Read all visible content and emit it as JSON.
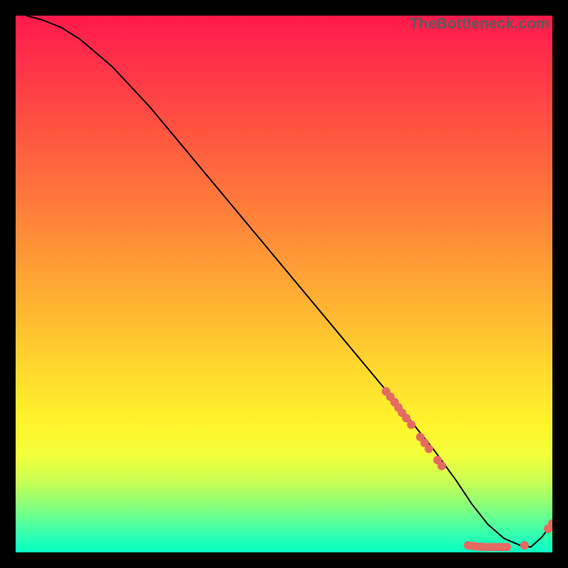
{
  "watermark": "TheBottleneck.com",
  "chart_data": {
    "type": "line",
    "title": "",
    "xlabel": "",
    "ylabel": "",
    "xlim": [
      0,
      100
    ],
    "ylim": [
      0,
      100
    ],
    "grid": false,
    "legend": false,
    "series": [
      {
        "name": "curve",
        "color": "#000000",
        "x": [
          2,
          5,
          8.5,
          12,
          18,
          25,
          35,
          45,
          55,
          65,
          70,
          74,
          78,
          82,
          85,
          88,
          91,
          94,
          96,
          98,
          100
        ],
        "y": [
          100,
          99.2,
          97.8,
          95.6,
          90.5,
          83,
          71,
          59,
          47,
          35,
          29,
          24,
          19,
          13.5,
          9,
          5.2,
          2.6,
          1.3,
          1.0,
          2.8,
          5.4
        ]
      }
    ],
    "point_clusters": [
      {
        "name": "upper-segment-dots",
        "color": "#e46a62",
        "radius_px": 6,
        "points": [
          {
            "x": 69.0,
            "y": 30.0
          },
          {
            "x": 69.8,
            "y": 29.0
          },
          {
            "x": 70.6,
            "y": 28.0
          },
          {
            "x": 71.3,
            "y": 27.0
          },
          {
            "x": 72.0,
            "y": 26.0
          },
          {
            "x": 72.8,
            "y": 25.0
          },
          {
            "x": 73.7,
            "y": 23.8
          },
          {
            "x": 75.4,
            "y": 21.5
          },
          {
            "x": 76.2,
            "y": 20.4
          },
          {
            "x": 77.0,
            "y": 19.3
          },
          {
            "x": 78.6,
            "y": 17.2
          },
          {
            "x": 79.4,
            "y": 16.1
          }
        ]
      },
      {
        "name": "bottom-flat-dots",
        "color": "#e46a62",
        "radius_px": 6,
        "points": [
          {
            "x": 84.3,
            "y": 1.3
          },
          {
            "x": 85.1,
            "y": 1.2
          },
          {
            "x": 85.9,
            "y": 1.1
          },
          {
            "x": 86.7,
            "y": 1.05
          },
          {
            "x": 87.5,
            "y": 1.0
          },
          {
            "x": 88.3,
            "y": 1.0
          },
          {
            "x": 89.1,
            "y": 1.0
          },
          {
            "x": 89.9,
            "y": 1.0
          },
          {
            "x": 90.7,
            "y": 1.0
          },
          {
            "x": 91.5,
            "y": 1.0
          },
          {
            "x": 94.8,
            "y": 1.3
          }
        ]
      },
      {
        "name": "rising-tail-dots",
        "color": "#e46a62",
        "radius_px": 6,
        "points": [
          {
            "x": 99.2,
            "y": 4.4
          },
          {
            "x": 100.0,
            "y": 5.4
          }
        ]
      }
    ]
  }
}
